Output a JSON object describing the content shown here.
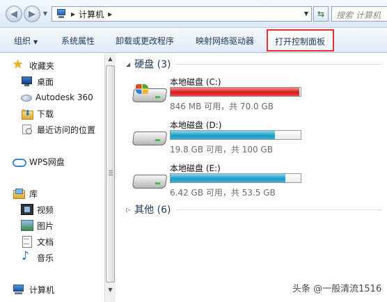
{
  "address": {
    "path_label": "计算机",
    "search_placeholder": "搜索 计算机"
  },
  "toolbar": {
    "organize": "组织",
    "system_properties": "系统属性",
    "uninstall": "卸载或更改程序",
    "map_drive": "映射网络驱动器",
    "open_control_panel": "打开控制面板"
  },
  "nav": {
    "favorites": "收藏夹",
    "desktop": "桌面",
    "autodesk": "Autodesk 360",
    "downloads": "下载",
    "recent": "最近访问的位置",
    "wps": "WPS网盘",
    "libraries": "库",
    "videos": "视频",
    "pictures": "图片",
    "documents": "文档",
    "music": "音乐",
    "computer": "计算机"
  },
  "content": {
    "hard_disks_header": "硬盘 (3)",
    "other_header": "其他 (6)",
    "drives": [
      {
        "name": "本地磁盘 (C:)",
        "free_text": "846 MB 可用，共 70.0 GB",
        "used_fraction": 0.99,
        "bar_color": "#d61a1a"
      },
      {
        "name": "本地磁盘 (D:)",
        "free_text": "19.8 GB 可用，共 100 GB",
        "used_fraction": 0.8,
        "bar_color": "#1f9bc3"
      },
      {
        "name": "本地磁盘 (E:)",
        "free_text": "6.42 GB 可用，共 53.5 GB",
        "used_fraction": 0.88,
        "bar_color": "#1f9bc3"
      }
    ]
  },
  "watermark": "头条 @一般清流1516",
  "colors": {
    "highlight_border": "#e8312f",
    "link_text": "#1e395b"
  }
}
